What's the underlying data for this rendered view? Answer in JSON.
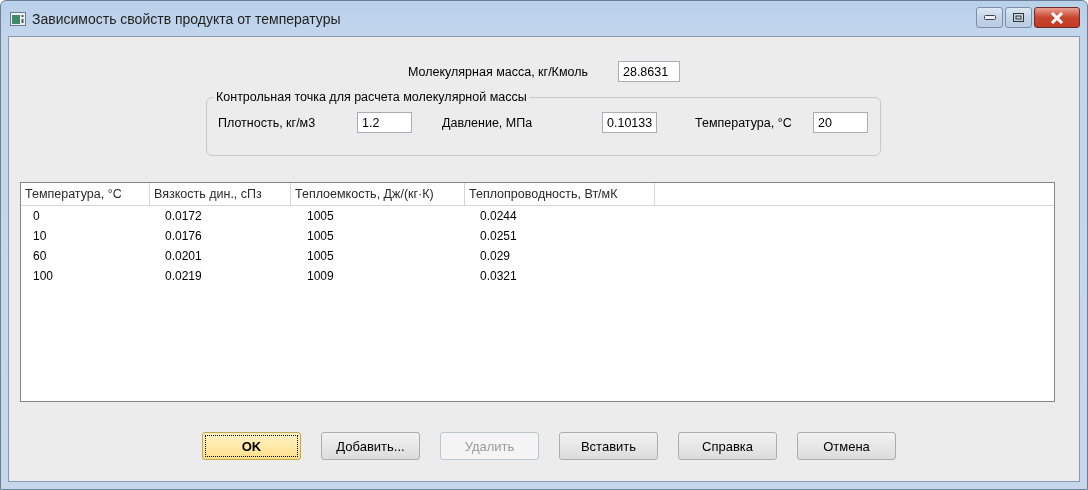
{
  "window": {
    "title": "Зависимость свойств продукта от температуры"
  },
  "molecular_mass": {
    "label": "Молекулярная масса, кг/Кмоль",
    "value": "28.8631"
  },
  "control_point": {
    "title": "Контрольная точка для расчета молекулярной массы",
    "fields": [
      {
        "label": "Плотность, кг/м3",
        "value": "1.2"
      },
      {
        "label": "Давление, МПа",
        "value": "0.10133"
      },
      {
        "label": "Температура, °C",
        "value": "20"
      }
    ]
  },
  "table": {
    "columns": [
      "Температура, °C",
      "Вязкость дин., сПз",
      "Теплоемкость, Дж/(кг·К)",
      "Теплопроводность, Вт/мК"
    ],
    "rows": [
      [
        "0",
        "0.0172",
        "1005",
        "0.0244"
      ],
      [
        "10",
        "0.0176",
        "1005",
        "0.0251"
      ],
      [
        "60",
        "0.0201",
        "1005",
        "0.029"
      ],
      [
        "100",
        "0.0219",
        "1009",
        "0.0321"
      ]
    ]
  },
  "buttons": [
    {
      "label": "OK",
      "default": true,
      "disabled": false
    },
    {
      "label": "Добавить...",
      "default": false,
      "disabled": false
    },
    {
      "label": "Удалить",
      "default": false,
      "disabled": true
    },
    {
      "label": "Вставить",
      "default": false,
      "disabled": false
    },
    {
      "label": "Справка",
      "default": false,
      "disabled": false
    },
    {
      "label": "Отмена",
      "default": false,
      "disabled": false
    }
  ]
}
